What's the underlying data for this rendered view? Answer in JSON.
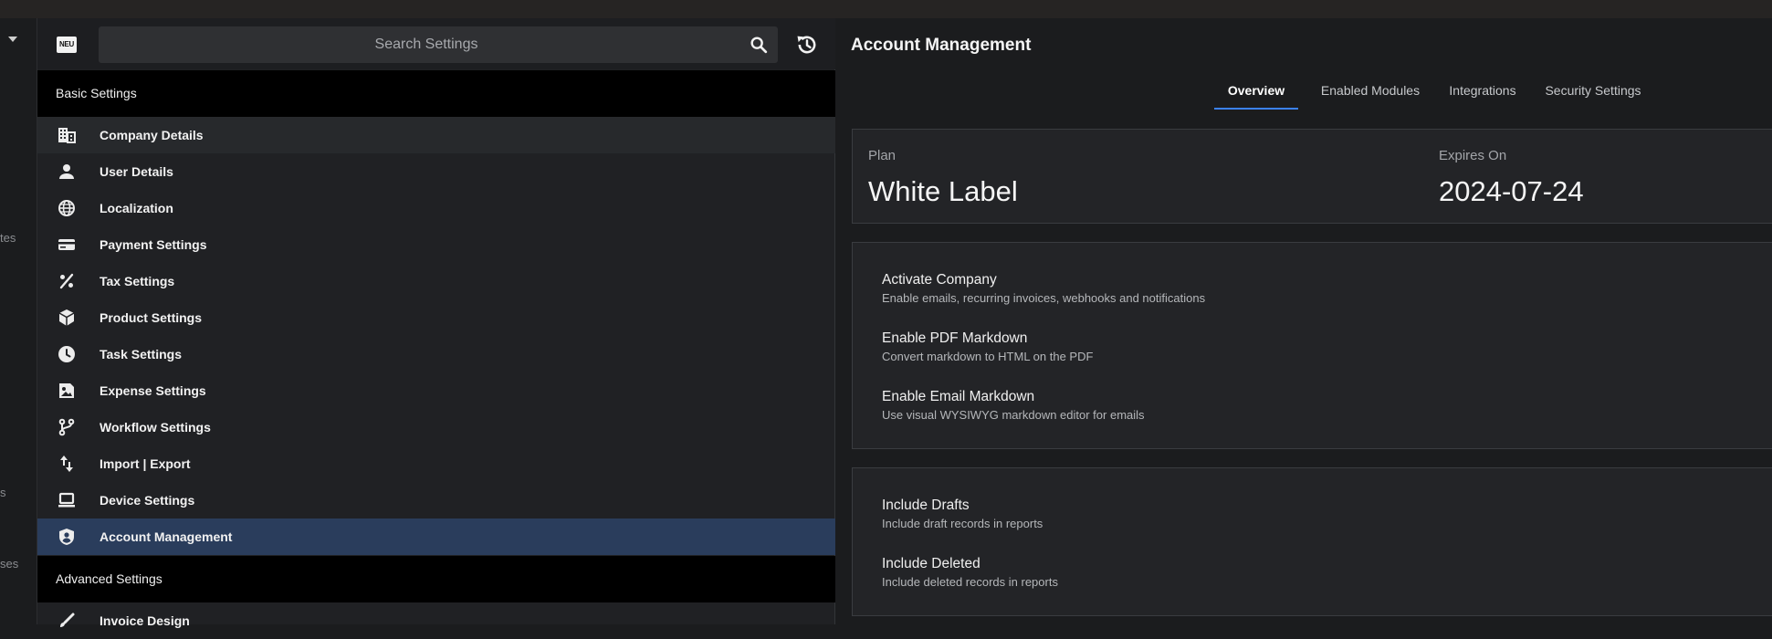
{
  "leftnav": {
    "fragments": [
      "tes",
      "s",
      "ses"
    ]
  },
  "search": {
    "placeholder": "Search Settings",
    "logo_text": "NEU"
  },
  "basic_settings": {
    "header": "Basic Settings",
    "items": [
      {
        "label": "Company Details",
        "icon": "building-icon"
      },
      {
        "label": "User Details",
        "icon": "person-icon"
      },
      {
        "label": "Localization",
        "icon": "globe-icon"
      },
      {
        "label": "Payment Settings",
        "icon": "credit-card-icon"
      },
      {
        "label": "Tax Settings",
        "icon": "percent-icon"
      },
      {
        "label": "Product Settings",
        "icon": "cube-icon"
      },
      {
        "label": "Task Settings",
        "icon": "clock-icon"
      },
      {
        "label": "Expense Settings",
        "icon": "receipt-image-icon"
      },
      {
        "label": "Workflow Settings",
        "icon": "branch-icon"
      },
      {
        "label": "Import | Export",
        "icon": "import-export-icon"
      },
      {
        "label": "Device Settings",
        "icon": "laptop-icon"
      },
      {
        "label": "Account Management",
        "icon": "shield-account-icon"
      }
    ]
  },
  "advanced_settings": {
    "header": "Advanced Settings",
    "items": [
      {
        "label": "Invoice Design",
        "icon": "brush-icon"
      }
    ]
  },
  "page": {
    "title": "Account Management",
    "tabs": [
      "Overview",
      "Enabled Modules",
      "Integrations",
      "Security Settings"
    ],
    "active_tab": "Overview"
  },
  "plan_card": {
    "plan_label": "Plan",
    "plan_value": "White Label",
    "expires_label": "Expires On",
    "expires_value": "2024-07-24"
  },
  "company_toggles": [
    {
      "title": "Activate Company",
      "subtitle": "Enable emails, recurring invoices, webhooks and notifications"
    },
    {
      "title": "Enable PDF Markdown",
      "subtitle": "Convert markdown to HTML on the PDF"
    },
    {
      "title": "Enable Email Markdown",
      "subtitle": "Use visual WYSIWYG markdown editor for emails"
    }
  ],
  "report_toggles": [
    {
      "title": "Include Drafts",
      "subtitle": "Include draft records in reports"
    },
    {
      "title": "Include Deleted",
      "subtitle": "Include deleted records in reports"
    }
  ],
  "colors": {
    "selected_row": "#2a3d5c",
    "tab_indicator": "#3b82f6"
  }
}
